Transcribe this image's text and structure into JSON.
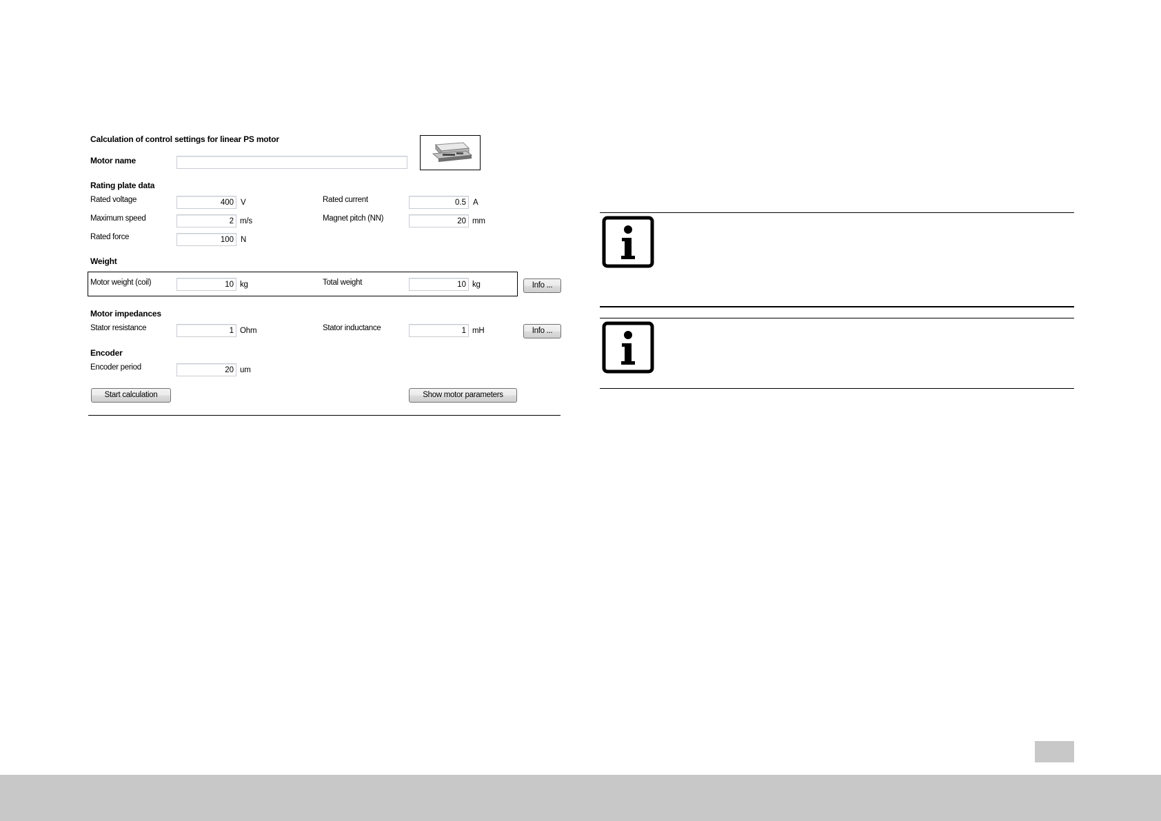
{
  "dialog": {
    "title": "Calculation of control settings for linear PS motor",
    "motor_name_label": "Motor name",
    "motor_name_value": "",
    "rating": {
      "heading": "Rating plate data",
      "rated_voltage": {
        "label": "Rated voltage",
        "value": "400",
        "unit": "V"
      },
      "maximum_speed": {
        "label": "Maximum speed",
        "value": "2",
        "unit": "m/s"
      },
      "rated_force": {
        "label": "Rated force",
        "value": "100",
        "unit": "N"
      },
      "rated_current": {
        "label": "Rated current",
        "value": "0.5",
        "unit": "A"
      },
      "magnet_pitch": {
        "label": "Magnet pitch (NN)",
        "value": "20",
        "unit": "mm"
      }
    },
    "weight": {
      "heading": "Weight",
      "motor_weight": {
        "label": "Motor weight (coil)",
        "value": "10",
        "unit": "kg"
      },
      "total_weight": {
        "label": "Total weight",
        "value": "10",
        "unit": "kg"
      },
      "info_button": "Info ..."
    },
    "impedances": {
      "heading": "Motor impedances",
      "stator_resistance": {
        "label": "Stator resistance",
        "value": "1",
        "unit": "Ohm"
      },
      "stator_inductance": {
        "label": "Stator inductance",
        "value": "1",
        "unit": "mH"
      },
      "info_button": "Info ..."
    },
    "encoder": {
      "heading": "Encoder",
      "encoder_period": {
        "label": "Encoder period",
        "value": "20",
        "unit": "um"
      }
    },
    "start_button": "Start calculation",
    "show_params_button": "Show motor parameters"
  },
  "icons": {
    "motor_image": "linear-motor-image",
    "note_1": "info-icon",
    "note_2": "info-icon"
  },
  "colors": {
    "footer": "#c8c8c8",
    "field_border": "#c8ccd2",
    "button_border": "#707070"
  }
}
